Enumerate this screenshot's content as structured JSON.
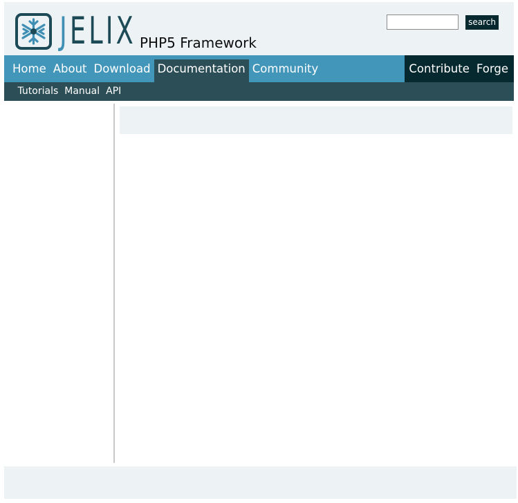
{
  "header": {
    "logo_icon": "jelix-snowflake-logo-icon",
    "logo_text_part1": "J",
    "logo_text_part2": "ELIX",
    "tagline": "PHP5 Framework",
    "search": {
      "value": "",
      "placeholder": "",
      "button_label": "search"
    }
  },
  "main_nav": {
    "items": [
      {
        "label": "Home"
      },
      {
        "label": "About"
      },
      {
        "label": "Download"
      },
      {
        "label": "Documentation",
        "active": true
      },
      {
        "label": "Community"
      }
    ],
    "right_items": [
      {
        "label": "Contribute"
      },
      {
        "label": "Forge"
      }
    ]
  },
  "sub_nav": {
    "items": [
      {
        "label": "Tutorials"
      },
      {
        "label": "Manual"
      },
      {
        "label": "API"
      }
    ]
  },
  "colors": {
    "header_bg": "#edf2f4",
    "nav_bg": "#4196ba",
    "nav_active_bg": "#2c4e57",
    "nav_right_bg": "#06282f",
    "subnav_bg": "#2c4e57",
    "logo_light": "#3f8fb4",
    "logo_dark": "#1d4a57"
  }
}
